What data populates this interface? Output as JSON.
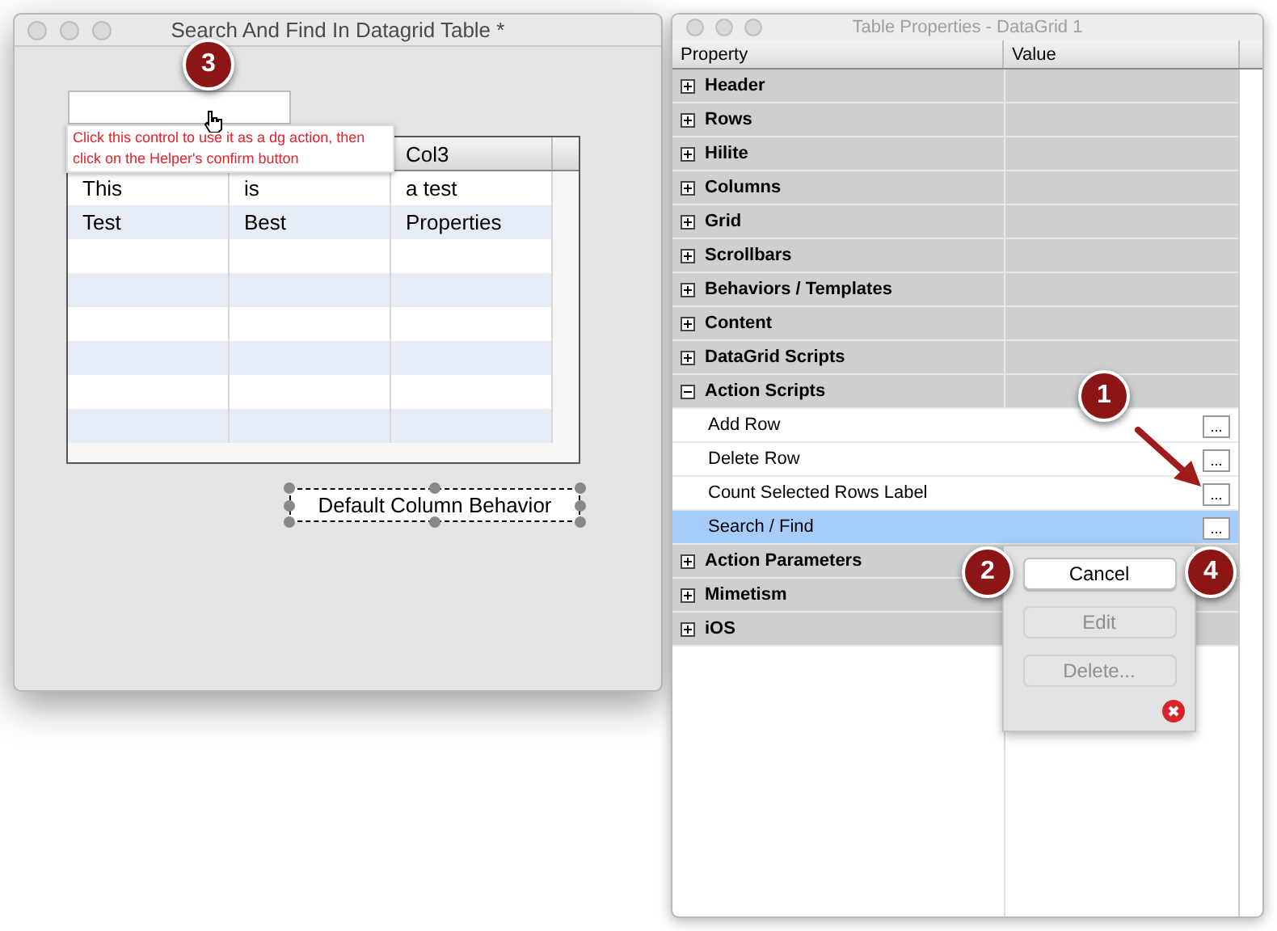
{
  "left_window": {
    "title": "Search And Find In Datagrid Table *",
    "tooltip": "Click this control to use it as a dg action, then click on the Helper's confirm button",
    "table": {
      "column_3_header": "Col3",
      "rows": [
        [
          "This",
          "is",
          "a test"
        ],
        [
          "Test",
          "Best",
          "Properties"
        ]
      ]
    },
    "selected_button": {
      "label": "Default Column Behavior",
      "selected": true
    }
  },
  "right_window": {
    "title": "Table Properties - DataGrid 1",
    "columns": [
      "Property",
      "Value"
    ],
    "rows": [
      {
        "kind": "group",
        "label": "Header",
        "expanded": false
      },
      {
        "kind": "group",
        "label": "Rows",
        "expanded": false
      },
      {
        "kind": "group",
        "label": "Hilite",
        "expanded": false
      },
      {
        "kind": "group",
        "label": "Columns",
        "expanded": false
      },
      {
        "kind": "group",
        "label": "Grid",
        "expanded": false
      },
      {
        "kind": "group",
        "label": "Scrollbars",
        "expanded": false
      },
      {
        "kind": "group",
        "label": "Behaviors / Templates",
        "expanded": false
      },
      {
        "kind": "group",
        "label": "Content",
        "expanded": false
      },
      {
        "kind": "group",
        "label": "DataGrid Scripts",
        "expanded": false
      },
      {
        "kind": "group",
        "label": "Action Scripts",
        "expanded": true
      },
      {
        "kind": "item",
        "label": "Add Row",
        "selected": false,
        "button": "..."
      },
      {
        "kind": "item",
        "label": "Delete Row",
        "selected": false,
        "button": "..."
      },
      {
        "kind": "item",
        "label": "Count Selected Rows Label",
        "selected": false,
        "button": "..."
      },
      {
        "kind": "item",
        "label": "Search / Find",
        "selected": true,
        "button": "..."
      },
      {
        "kind": "group",
        "label": "Action Parameters",
        "expanded": false
      },
      {
        "kind": "group",
        "label": "Mimetism",
        "expanded": false
      },
      {
        "kind": "group",
        "label": "iOS",
        "expanded": false
      }
    ],
    "popup": {
      "buttons": [
        {
          "label": "Cancel",
          "disabled": false
        },
        {
          "label": "Edit",
          "disabled": true
        },
        {
          "label": "Delete...",
          "disabled": true
        }
      ]
    }
  },
  "callouts": [
    "1",
    "2",
    "3",
    "4"
  ]
}
